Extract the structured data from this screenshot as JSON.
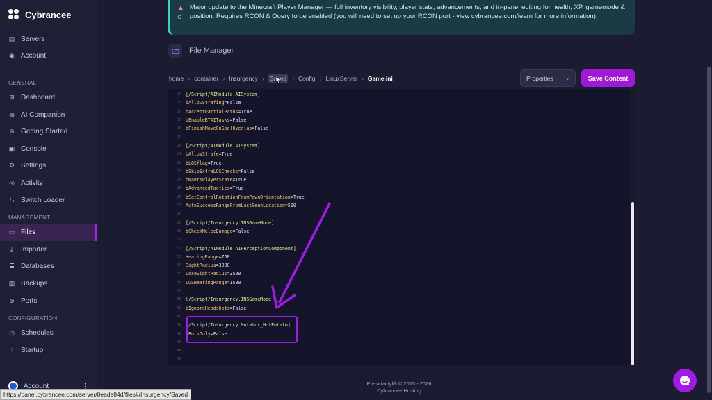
{
  "app": {
    "brand": "Cybrancee"
  },
  "sidebar": {
    "top_items": [
      {
        "label": "Servers",
        "icon": "server-icon"
      },
      {
        "label": "Account",
        "icon": "account-icon"
      }
    ],
    "general_label": "GENERAL",
    "general_items": [
      {
        "label": "Dashboard",
        "icon": "dashboard-icon"
      },
      {
        "label": "AI Companion",
        "icon": "chat-icon"
      },
      {
        "label": "Getting Started",
        "icon": "compass-icon"
      },
      {
        "label": "Console",
        "icon": "terminal-icon"
      },
      {
        "label": "Settings",
        "icon": "gear-icon"
      },
      {
        "label": "Activity",
        "icon": "activity-icon"
      },
      {
        "label": "Switch Loader",
        "icon": "switch-icon"
      }
    ],
    "management_label": "MANAGEMENT",
    "management_items": [
      {
        "label": "Files",
        "icon": "folder-icon",
        "active": true
      },
      {
        "label": "Importer",
        "icon": "download-icon"
      },
      {
        "label": "Databases",
        "icon": "database-icon"
      },
      {
        "label": "Backups",
        "icon": "archive-icon"
      },
      {
        "label": "Ports",
        "icon": "network-icon"
      }
    ],
    "configuration_label": "CONFIGURATION",
    "configuration_items": [
      {
        "label": "Schedules",
        "icon": "clock-icon"
      },
      {
        "label": "Startup",
        "icon": "sliders-icon"
      }
    ],
    "bottom_account": "Account"
  },
  "banner": {
    "text": "Major update to the Minecraft Player Manager — full inventory visibility, player stats, advancements, and in-panel editing for health, XP, gamemode & position. Requires RCON & Query to be enabled (you will need to set up your RCON port - view cybrancee.com/learn for more information)."
  },
  "file_manager": {
    "title": "File Manager"
  },
  "breadcrumb": [
    "home",
    "container",
    "Insurgency",
    "Saved",
    "Config",
    "LinuxServer",
    "Game.ini"
  ],
  "controls": {
    "properties_label": "Properties",
    "save_label": "Save Content"
  },
  "editor": {
    "lines": [
      {
        "n": "14",
        "text": "[/Script/AIModule.AISystem]",
        "hdr": true
      },
      {
        "n": "15",
        "key": "bAllowStrafing",
        "val": "=False"
      },
      {
        "n": "16",
        "key": "bAcceptPartialPaths",
        "val": "=True"
      },
      {
        "n": "17",
        "key": "bEnableBTAITasks",
        "val": "=False"
      },
      {
        "n": "18",
        "key": "bFinishMoveOnGoalOverlap",
        "val": "=False"
      },
      {
        "n": "19",
        "text": ""
      },
      {
        "n": "20",
        "text": "[/Script/AIModule.AISystem]",
        "hdr": true
      },
      {
        "n": "21",
        "key": "bAllowStrafe",
        "val": "=True"
      },
      {
        "n": "22",
        "key": "bLOSflag",
        "val": "=True"
      },
      {
        "n": "23",
        "key": "bSkipExtraLOSChecks",
        "val": "=False"
      },
      {
        "n": "24",
        "key": "bWantsPlayerState",
        "val": "=True"
      },
      {
        "n": "25",
        "key": "bAdvancedTactics",
        "val": "=True"
      },
      {
        "n": "26",
        "key": "bSetControlRotationFromPawnOrientation",
        "val": "=True"
      },
      {
        "n": "27",
        "key": "AutoSuccessRangeFromLastSeenLocation",
        "val": "=500"
      },
      {
        "n": "28",
        "text": ""
      },
      {
        "n": "29",
        "text": "[/Script/Insurgency.INSGameMode]",
        "hdr": true
      },
      {
        "n": "30",
        "key": "bCheckMeleeDamage",
        "val": "=False"
      },
      {
        "n": "31",
        "text": ""
      },
      {
        "n": "32",
        "text": "[/Script/AIModule.AIPerceptionComponent]",
        "hdr": true
      },
      {
        "n": "33",
        "key": "HearingRange",
        "val": "=768"
      },
      {
        "n": "34",
        "key": "SightRadius",
        "val": "=3000"
      },
      {
        "n": "35",
        "key": "LoseSightRadius",
        "val": "=3500"
      },
      {
        "n": "36",
        "key": "LOSHearingRange",
        "val": "=1500"
      },
      {
        "n": "37",
        "text": ""
      },
      {
        "n": "38",
        "text": "[/Script/Insurgency.INSGameMode]",
        "hdr": true
      },
      {
        "n": "39",
        "key": "bIgnoreHeadshots",
        "val": "=False"
      },
      {
        "n": "40",
        "text": ""
      },
      {
        "n": "41",
        "text": "[/Script/Insurgency.Mutator_HotPotato]",
        "hdr": true
      },
      {
        "n": "42",
        "key": "bBotsOnly",
        "val": "=False"
      },
      {
        "n": "43",
        "text": ""
      },
      {
        "n": "44",
        "text": ""
      },
      {
        "n": "45",
        "text": ""
      }
    ]
  },
  "footer": {
    "line1": "Pterodactyl® © 2015 - 2026",
    "line2": "Cybrancee Hosting"
  },
  "status_url": "https://panel.cybrancee.com/server/8eade84d/files#/Insurgency/Saved",
  "colors": {
    "accent": "#a118d6",
    "banner_border": "#2dd4bf",
    "background": "#1b1b31"
  }
}
